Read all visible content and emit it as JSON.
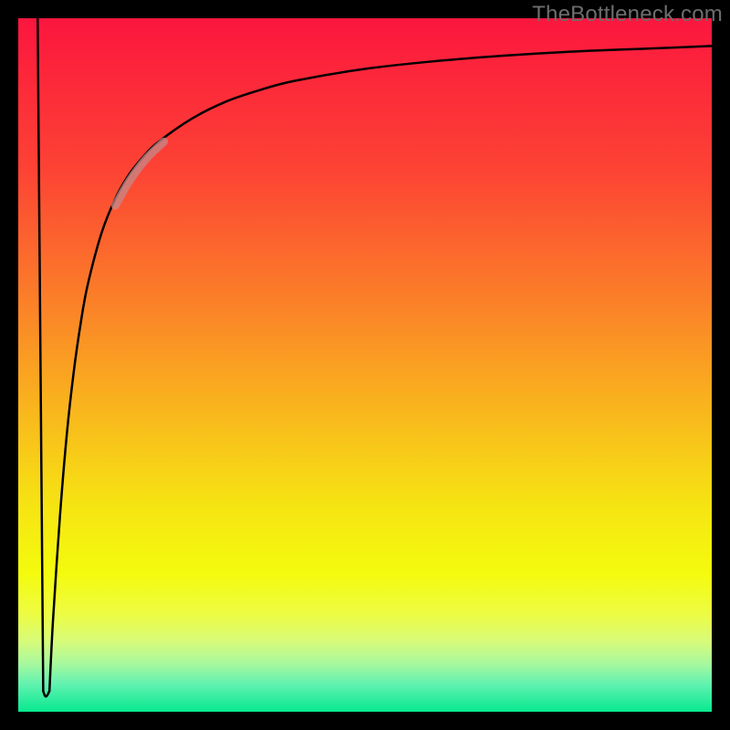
{
  "watermark": "TheBottleneck.com",
  "chart_data": {
    "type": "line",
    "title": "",
    "xlabel": "",
    "ylabel": "",
    "xlim": [
      0,
      100
    ],
    "ylim": [
      0,
      100
    ],
    "background_gradient": {
      "stops": [
        {
          "offset": 0.0,
          "color": "#fb163e"
        },
        {
          "offset": 0.22,
          "color": "#fd4334"
        },
        {
          "offset": 0.4,
          "color": "#fb7d29"
        },
        {
          "offset": 0.55,
          "color": "#f9b11e"
        },
        {
          "offset": 0.7,
          "color": "#f6e313"
        },
        {
          "offset": 0.8,
          "color": "#f4fb0d"
        },
        {
          "offset": 0.86,
          "color": "#edfc44"
        },
        {
          "offset": 0.9,
          "color": "#d6fb7c"
        },
        {
          "offset": 0.93,
          "color": "#a8f99d"
        },
        {
          "offset": 0.96,
          "color": "#62f2b0"
        },
        {
          "offset": 1.0,
          "color": "#06e98f"
        }
      ]
    },
    "series": [
      {
        "name": "down-segment",
        "stroke": "#000000",
        "stroke_width": 2.5,
        "points": [
          {
            "x": 2.8,
            "y": 100.0
          },
          {
            "x": 3.6,
            "y": 3.0
          }
        ]
      },
      {
        "name": "dip-bottom",
        "stroke": "#000000",
        "stroke_width": 2.5,
        "points": [
          {
            "x": 3.6,
            "y": 3.0
          },
          {
            "x": 3.8,
            "y": 2.4
          },
          {
            "x": 4.0,
            "y": 2.2
          },
          {
            "x": 4.2,
            "y": 2.4
          },
          {
            "x": 4.5,
            "y": 3.0
          }
        ]
      },
      {
        "name": "rising-curve",
        "stroke": "#000000",
        "stroke_width": 2.5,
        "points": [
          {
            "x": 4.5,
            "y": 3.0
          },
          {
            "x": 5.0,
            "y": 13.0
          },
          {
            "x": 6.0,
            "y": 28.0
          },
          {
            "x": 7.0,
            "y": 40.0
          },
          {
            "x": 8.0,
            "y": 49.0
          },
          {
            "x": 9.0,
            "y": 56.0
          },
          {
            "x": 10.0,
            "y": 61.5
          },
          {
            "x": 12.0,
            "y": 69.0
          },
          {
            "x": 14.0,
            "y": 74.0
          },
          {
            "x": 16.0,
            "y": 77.5
          },
          {
            "x": 18.0,
            "y": 80.0
          },
          {
            "x": 20.0,
            "y": 82.0
          },
          {
            "x": 25.0,
            "y": 85.5
          },
          {
            "x": 30.0,
            "y": 88.0
          },
          {
            "x": 35.0,
            "y": 89.7
          },
          {
            "x": 40.0,
            "y": 91.0
          },
          {
            "x": 50.0,
            "y": 92.7
          },
          {
            "x": 60.0,
            "y": 93.8
          },
          {
            "x": 70.0,
            "y": 94.6
          },
          {
            "x": 80.0,
            "y": 95.2
          },
          {
            "x": 90.0,
            "y": 95.6
          },
          {
            "x": 100.0,
            "y": 96.0
          }
        ]
      },
      {
        "name": "highlight-overlay",
        "stroke": "#c38989",
        "stroke_width": 9,
        "opacity": 0.75,
        "points": [
          {
            "x": 14.0,
            "y": 73.0
          },
          {
            "x": 16.0,
            "y": 76.5
          },
          {
            "x": 18.5,
            "y": 79.8
          },
          {
            "x": 21.0,
            "y": 82.2
          }
        ]
      }
    ]
  }
}
